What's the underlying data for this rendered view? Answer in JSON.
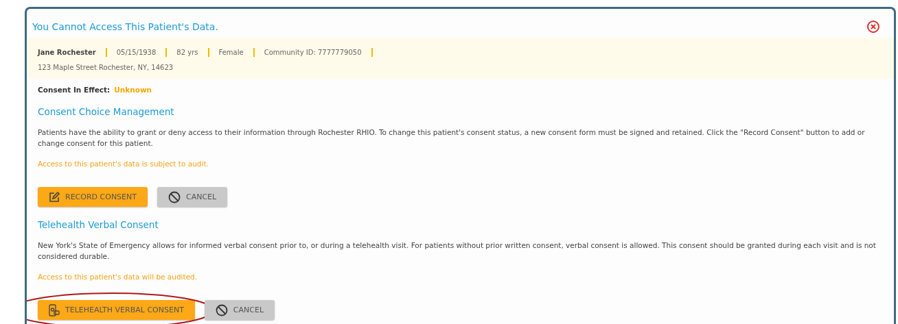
{
  "dialog": {
    "title": "You Cannot Access This Patient's Data.",
    "patient": {
      "fields": [
        "Jane Rochester",
        "05/15/1938",
        "82 yrs",
        "Female",
        "Community ID: 7777779050"
      ],
      "address": "123 Maple Street Rochester, NY, 14623"
    },
    "consent_in_effect": {
      "label": "Consent In Effect:",
      "value": "Unknown"
    },
    "sections": [
      {
        "heading": "Consent Choice Management",
        "text": "Patients have the ability to grant or deny access to their information through Rochester RHIO. To change this patient's consent status, a new consent form must be signed and retained. Click the \"Record Consent\" button to add or change consent for this patient.",
        "notice": "Access to this patient's data is subject to audit.",
        "buttons": [
          {
            "kind": "record",
            "label": "RECORD CONSENT",
            "highlighted": false
          },
          {
            "kind": "cancel",
            "label": "CANCEL",
            "highlighted": false
          }
        ]
      },
      {
        "heading": "Telehealth Verbal Consent",
        "text": "New York's State of Emergency allows for informed verbal consent prior to, or during a telehealth visit. For patients without prior written consent, verbal consent is allowed. This consent should be granted during each visit and is not considered durable.",
        "notice": "Access to this patient's data will be audited.",
        "buttons": [
          {
            "kind": "telehealth",
            "label": "TELEHEALTH VERBAL CONSENT",
            "highlighted": true
          },
          {
            "kind": "cancel",
            "label": "CANCEL",
            "highlighted": false
          }
        ]
      }
    ]
  }
}
